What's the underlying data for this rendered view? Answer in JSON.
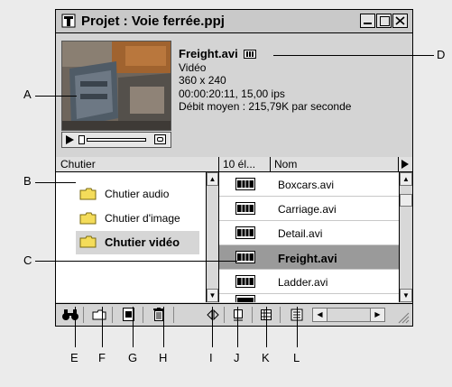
{
  "window": {
    "title": "Projet : Voie ferrée.ppj"
  },
  "clip_info": {
    "name": "Freight.avi",
    "type": "Vidéo",
    "dimensions": "360 x 240",
    "timecode": "00:00:20:11, 15,00 ips",
    "bitrate": "Débit moyen : 215,79K par seconde"
  },
  "bins_pane": {
    "header": "Chutier",
    "items": [
      {
        "label": "Chutier audio",
        "selected": false
      },
      {
        "label": "Chutier d'image",
        "selected": false
      },
      {
        "label": "Chutier vidéo",
        "selected": true
      }
    ]
  },
  "files_pane": {
    "count_header": "10 él...",
    "name_header": "Nom",
    "items": [
      {
        "label": "Boxcars.avi",
        "selected": false
      },
      {
        "label": "Carriage.avi",
        "selected": false
      },
      {
        "label": "Detail.avi",
        "selected": false
      },
      {
        "label": "Freight.avi",
        "selected": true
      },
      {
        "label": "Ladder.avi",
        "selected": false
      }
    ]
  },
  "callouts": {
    "A": "A",
    "B": "B",
    "C": "C",
    "D": "D",
    "E": "E",
    "F": "F",
    "G": "G",
    "H": "H",
    "I": "I",
    "J": "J",
    "K": "K",
    "L": "L"
  },
  "icons": {
    "find": "binoculars-icon",
    "new_bin": "folder-icon",
    "new_item": "new-item-icon",
    "delete": "trash-icon",
    "resize": "pane-resize-icon",
    "icon_view": "icon-view-icon",
    "thumbnail_view": "thumbnail-view-icon",
    "list_view": "list-view-icon"
  }
}
